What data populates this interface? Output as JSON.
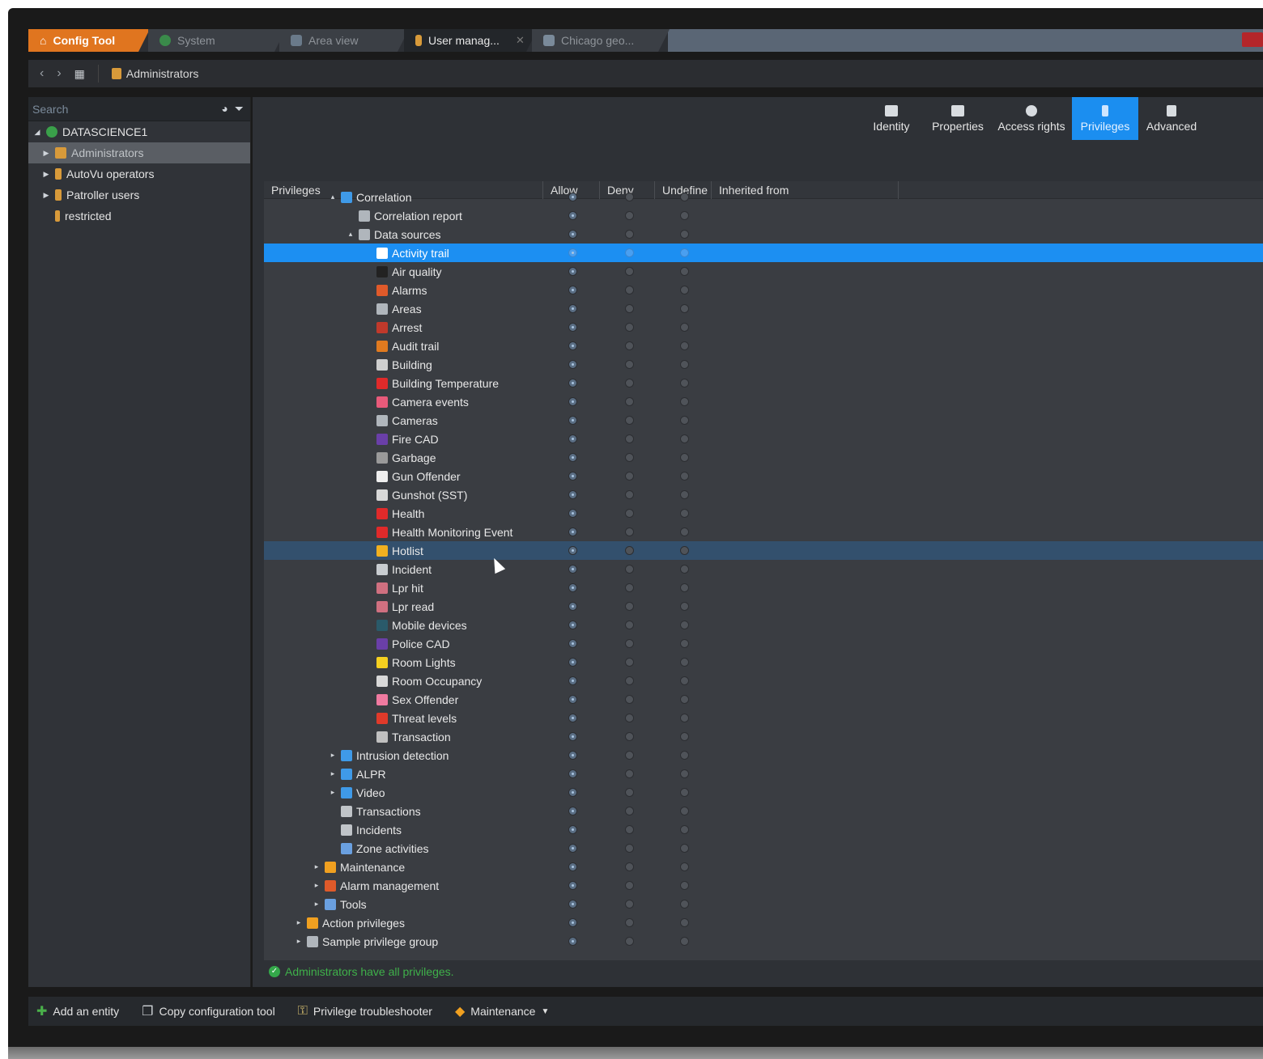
{
  "tabs": [
    {
      "label": "Config Tool",
      "icon": "home-icon",
      "kind": "config"
    },
    {
      "label": "System",
      "icon": "system-icon",
      "kind": "inactive"
    },
    {
      "label": "Area view",
      "icon": "area-view-icon",
      "kind": "inactive"
    },
    {
      "label": "User manag...",
      "icon": "user-icon",
      "kind": "active",
      "closable": true
    },
    {
      "label": "Chicago geo...",
      "icon": "map-icon",
      "kind": "inactive"
    }
  ],
  "breadcrumb": {
    "label": "Administrators"
  },
  "search": {
    "placeholder": "Search"
  },
  "sidebar": {
    "root": "DATASCIENCE1",
    "items": [
      {
        "label": "Administrators",
        "selected": true,
        "expandable": true
      },
      {
        "label": "AutoVu operators",
        "expandable": true
      },
      {
        "label": "Patroller users",
        "expandable": true
      },
      {
        "label": "restricted",
        "expandable": false
      }
    ]
  },
  "toptabs": [
    {
      "label": "Identity",
      "icon": "identity-icon"
    },
    {
      "label": "Properties",
      "icon": "properties-icon"
    },
    {
      "label": "Access rights",
      "icon": "access-rights-icon"
    },
    {
      "label": "Privileges",
      "icon": "privileges-icon",
      "active": true
    },
    {
      "label": "Advanced",
      "icon": "advanced-icon"
    }
  ],
  "grid": {
    "columns": [
      "Privileges",
      "Allow",
      "Deny",
      "Undefine",
      "Inherited from"
    ],
    "rows": [
      {
        "label": "Correlation",
        "level": 2,
        "caret": "▴",
        "color": "#3f9ae8"
      },
      {
        "label": "Correlation report",
        "level": 3,
        "caret": "",
        "color": "#b0b6bc"
      },
      {
        "label": "Data sources",
        "level": 3,
        "caret": "▴",
        "color": "#b0b6bc"
      },
      {
        "label": "Activity trail",
        "level": 4,
        "caret": "",
        "color": "#ffffff",
        "state": "selected"
      },
      {
        "label": "Air quality",
        "level": 4,
        "caret": "",
        "color": "#222222"
      },
      {
        "label": "Alarms",
        "level": 4,
        "caret": "",
        "color": "#e05a2a"
      },
      {
        "label": "Areas",
        "level": 4,
        "caret": "",
        "color": "#b0b6bc"
      },
      {
        "label": "Arrest",
        "level": 4,
        "caret": "",
        "color": "#c0392b"
      },
      {
        "label": "Audit trail",
        "level": 4,
        "caret": "",
        "color": "#e07a1f"
      },
      {
        "label": "Building",
        "level": 4,
        "caret": "",
        "color": "#cfcfcf"
      },
      {
        "label": "Building Temperature",
        "level": 4,
        "caret": "",
        "color": "#e02a2a"
      },
      {
        "label": "Camera events",
        "level": 4,
        "caret": "",
        "color": "#e85a7a"
      },
      {
        "label": "Cameras",
        "level": 4,
        "caret": "",
        "color": "#b0b6bc"
      },
      {
        "label": "Fire CAD",
        "level": 4,
        "caret": "",
        "color": "#6a3fa8"
      },
      {
        "label": "Garbage",
        "level": 4,
        "caret": "",
        "color": "#9a9a9a"
      },
      {
        "label": "Gun Offender",
        "level": 4,
        "caret": "",
        "color": "#eeeeee"
      },
      {
        "label": "Gunshot (SST)",
        "level": 4,
        "caret": "",
        "color": "#d8d8d8"
      },
      {
        "label": "Health",
        "level": 4,
        "caret": "",
        "color": "#e02a2a"
      },
      {
        "label": "Health Monitoring Event",
        "level": 4,
        "caret": "",
        "color": "#e02a2a"
      },
      {
        "label": "Hotlist",
        "level": 4,
        "caret": "",
        "color": "#f0b020",
        "state": "hover"
      },
      {
        "label": "Incident",
        "level": 4,
        "caret": "",
        "color": "#c8ccd0"
      },
      {
        "label": "Lpr hit",
        "level": 4,
        "caret": "",
        "color": "#d07080"
      },
      {
        "label": "Lpr read",
        "level": 4,
        "caret": "",
        "color": "#d07080"
      },
      {
        "label": "Mobile devices",
        "level": 4,
        "caret": "",
        "color": "#2a5a6a"
      },
      {
        "label": "Police CAD",
        "level": 4,
        "caret": "",
        "color": "#6a3fa8"
      },
      {
        "label": "Room Lights",
        "level": 4,
        "caret": "",
        "color": "#f5d020"
      },
      {
        "label": "Room Occupancy",
        "level": 4,
        "caret": "",
        "color": "#d8d8d8"
      },
      {
        "label": "Sex Offender",
        "level": 4,
        "caret": "",
        "color": "#f07aa0"
      },
      {
        "label": "Threat levels",
        "level": 4,
        "caret": "",
        "color": "#e03a2a"
      },
      {
        "label": "Transaction",
        "level": 4,
        "caret": "",
        "color": "#c0c0c0"
      },
      {
        "label": "Intrusion detection",
        "level": 2,
        "caret": "▸",
        "color": "#3f9ae8"
      },
      {
        "label": "ALPR",
        "level": 2,
        "caret": "▸",
        "color": "#3f9ae8"
      },
      {
        "label": "Video",
        "level": 2,
        "caret": "▸",
        "color": "#3f9ae8"
      },
      {
        "label": "Transactions",
        "level": 2,
        "caret": "",
        "color": "#c0c4c8"
      },
      {
        "label": "Incidents",
        "level": 2,
        "caret": "",
        "color": "#c0c4c8"
      },
      {
        "label": "Zone activities",
        "level": 2,
        "caret": "",
        "color": "#6aa0e0"
      },
      {
        "label": "Maintenance",
        "level": 1,
        "caret": "▸",
        "color": "#f0a020"
      },
      {
        "label": "Alarm management",
        "level": 1,
        "caret": "▸",
        "color": "#e05a2a"
      },
      {
        "label": "Tools",
        "level": 1,
        "caret": "▸",
        "color": "#6aa0e0"
      },
      {
        "label": "Action privileges",
        "level": 0,
        "caret": "▸",
        "color": "#f0a020"
      },
      {
        "label": "Sample privilege group",
        "level": 0,
        "caret": "▸",
        "color": "#b0b6bc"
      }
    ]
  },
  "status": {
    "text": "Administrators have all privileges."
  },
  "footer": {
    "add": "Add an entity",
    "copy": "Copy configuration tool",
    "troubleshooter": "Privilege troubleshooter",
    "maintenance": "Maintenance"
  },
  "colors": {
    "accent": "#1b8ef0",
    "config_tab": "#e0751f",
    "status_ok": "#3fb04a"
  }
}
